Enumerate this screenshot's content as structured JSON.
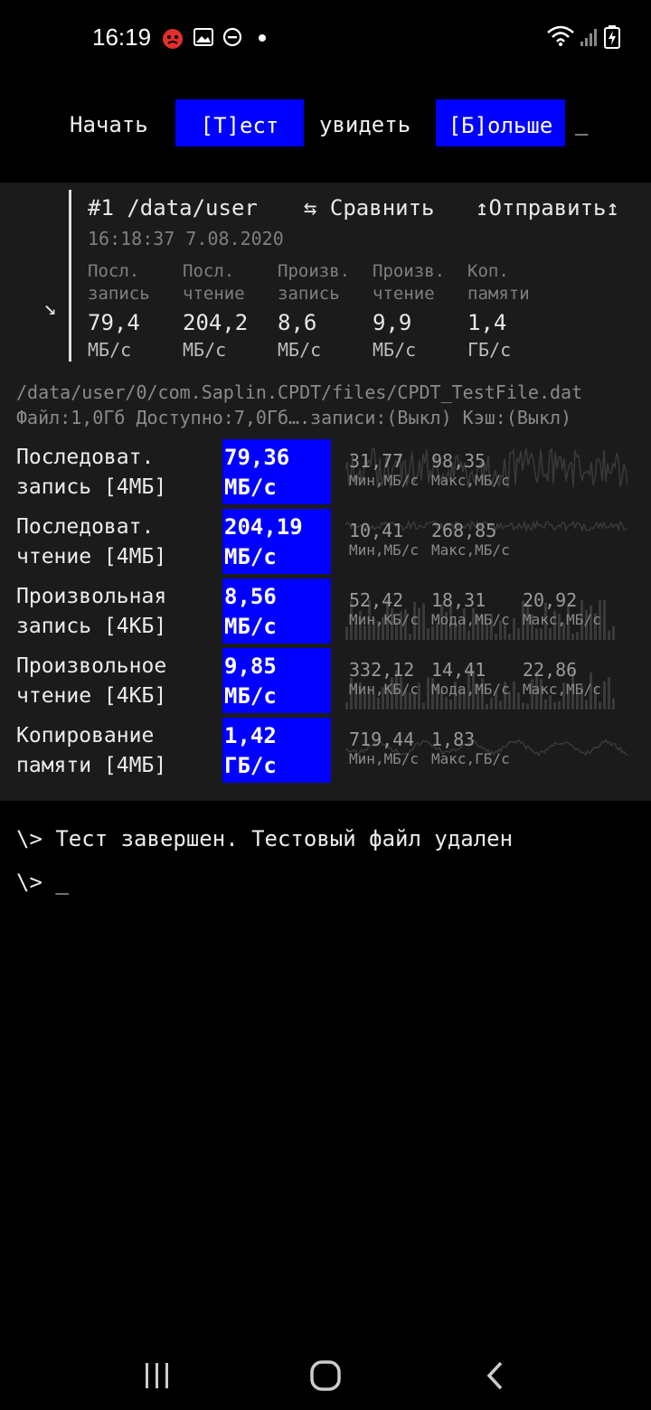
{
  "status_bar": {
    "time": "16:19",
    "icons": [
      "notification-app-icon",
      "gallery-icon",
      "dnd-icon",
      "dot-icon",
      "wifi-icon",
      "signal-icon",
      "battery-charging-icon"
    ]
  },
  "header": {
    "start_label": "Начать",
    "test_button": "[Т]ест",
    "see_label": "увидеть",
    "more_button": "[Б]ольше",
    "cursor": "_"
  },
  "run": {
    "title": "#1 /data/user",
    "compare": "⇆ Сравнить",
    "send": "↥Отправить↥",
    "timestamp": "16:18:37 7.08.2020",
    "summary": [
      {
        "label1": "Посл.",
        "label2": "запись",
        "value": "79,4",
        "unit": "МБ/с"
      },
      {
        "label1": "Посл.",
        "label2": "чтение",
        "value": "204,2",
        "unit": "МБ/с"
      },
      {
        "label1": "Произв.",
        "label2": "запись",
        "value": "8,6",
        "unit": "МБ/с"
      },
      {
        "label1": "Произв.",
        "label2": "чтение",
        "value": "9,9",
        "unit": "МБ/с"
      },
      {
        "label1": "Коп.",
        "label2": "памяти",
        "value": "1,4",
        "unit": "ГБ/с"
      }
    ]
  },
  "file": {
    "path": "/data/user/0/com.Saplin.CPDT/files/CPDT_TestFile.dat",
    "info": "Файл:1,0Гб Доступно:7,0Гб….записи:(Выкл) Кэш:(Выкл)"
  },
  "results": [
    {
      "label1": "Последоват.",
      "label2": "запись [4МБ]",
      "value1": "79,36",
      "value2": "МБ/с",
      "stats": [
        {
          "v": "31,77",
          "l": "Мин,МБ/с"
        },
        {
          "v": "98,35",
          "l": "Макс,МБ/с"
        }
      ]
    },
    {
      "label1": "Последоват.",
      "label2": "чтение [4МБ]",
      "value1": "204,19",
      "value2": "МБ/с",
      "stats": [
        {
          "v": "10,41",
          "l": "Мин,МБ/с"
        },
        {
          "v": "268,85",
          "l": "Макс,МБ/с"
        }
      ]
    },
    {
      "label1": "Произвольная",
      "label2": "запись [4КБ]",
      "value1": "8,56",
      "value2": "МБ/с",
      "stats": [
        {
          "v": "52,42",
          "l": "Мин,КБ/с"
        },
        {
          "v": "18,31",
          "l": "Мода,МБ/с"
        },
        {
          "v": "20,92",
          "l": "Макс,МБ/с"
        }
      ]
    },
    {
      "label1": "Произвольное",
      "label2": "чтение [4КБ]",
      "value1": "9,85",
      "value2": "МБ/с",
      "stats": [
        {
          "v": "332,12",
          "l": "Мин,КБ/с"
        },
        {
          "v": "14,41",
          "l": "Мода,МБ/с"
        },
        {
          "v": "22,86",
          "l": "Макс,МБ/с"
        }
      ]
    },
    {
      "label1": "Копирование",
      "label2": "памяти [4МБ]",
      "value1": "1,42",
      "value2": "ГБ/с",
      "stats": [
        {
          "v": "719,44",
          "l": "Мин,МБ/с"
        },
        {
          "v": "1,83",
          "l": "Макс,ГБ/с"
        }
      ]
    }
  ],
  "console": {
    "line1": "\\> Тест завершен. Тестовый файл удален",
    "line2": "\\> _"
  },
  "nav": {
    "icons": [
      "recents-icon",
      "home-icon",
      "back-icon"
    ]
  },
  "colors": {
    "accent": "#0000ff",
    "panel": "#1b1b1b",
    "background": "#000000"
  }
}
